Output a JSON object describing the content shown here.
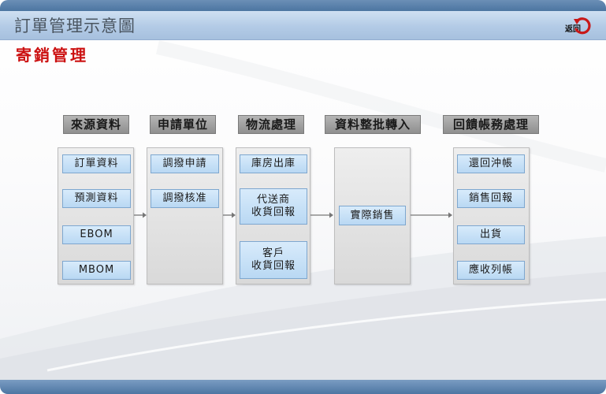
{
  "header": {
    "title": "訂單管理示意圖",
    "back_label": "返回"
  },
  "section": {
    "title": "寄銷管理"
  },
  "diagram": {
    "columns": [
      {
        "header": "來源資料",
        "items": [
          "訂單資料",
          "預測資料",
          "EBOM",
          "MBOM"
        ]
      },
      {
        "header": "申請單位",
        "items": [
          "調撥申請",
          "調撥核准"
        ]
      },
      {
        "header": "物流處理",
        "items": [
          "庫房出庫",
          "代送商\n收貨回報",
          "客戶\n收貨回報"
        ]
      },
      {
        "header": "資料整批轉入",
        "items": [
          "實際銷售"
        ]
      },
      {
        "header": "回饋帳務處理",
        "items": [
          "還回沖帳",
          "銷售回報",
          "出貨",
          "應收列帳"
        ]
      }
    ]
  }
}
